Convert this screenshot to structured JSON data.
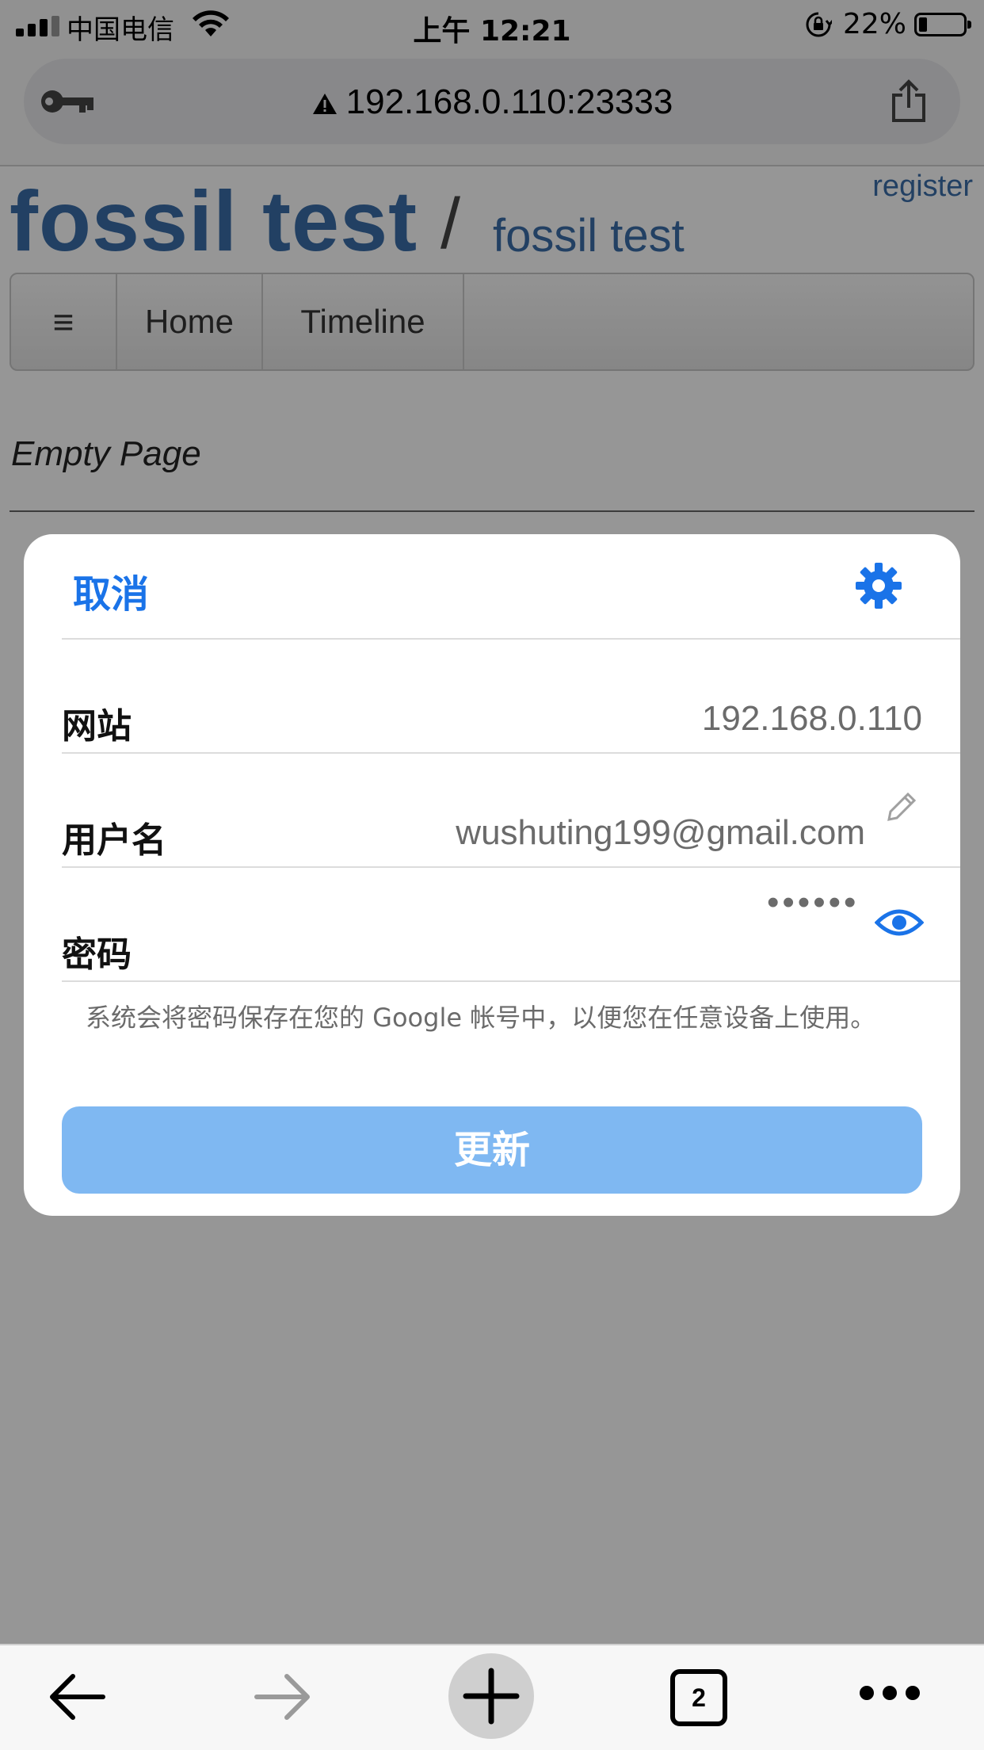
{
  "status_bar": {
    "carrier": "中国电信",
    "time": "上午 12:21",
    "battery_percent": "22%",
    "battery_level": 0.22
  },
  "browser": {
    "url": "192.168.0.110:23333"
  },
  "page": {
    "site_title": "fossil test",
    "separator": "/",
    "sub_title": "fossil test",
    "register_link": "register",
    "menu": {
      "hamburger": "≡",
      "items": [
        "Home",
        "Timeline"
      ]
    },
    "content": "Empty Page"
  },
  "dialog": {
    "cancel_label": "取消",
    "rows": {
      "site": {
        "label": "网站",
        "value": "192.168.0.110"
      },
      "username": {
        "label": "用户名",
        "value": "wushuting199@gmail.com"
      },
      "password": {
        "label": "密码",
        "value": "••••••"
      }
    },
    "note": "系统会将密码保存在您的 Google 帐号中，以便您在任意设备上使用。",
    "update_label": "更新",
    "accent_color": "#1a73e8",
    "button_color": "#7fb8f2"
  },
  "toolbar": {
    "tab_count": "2"
  }
}
